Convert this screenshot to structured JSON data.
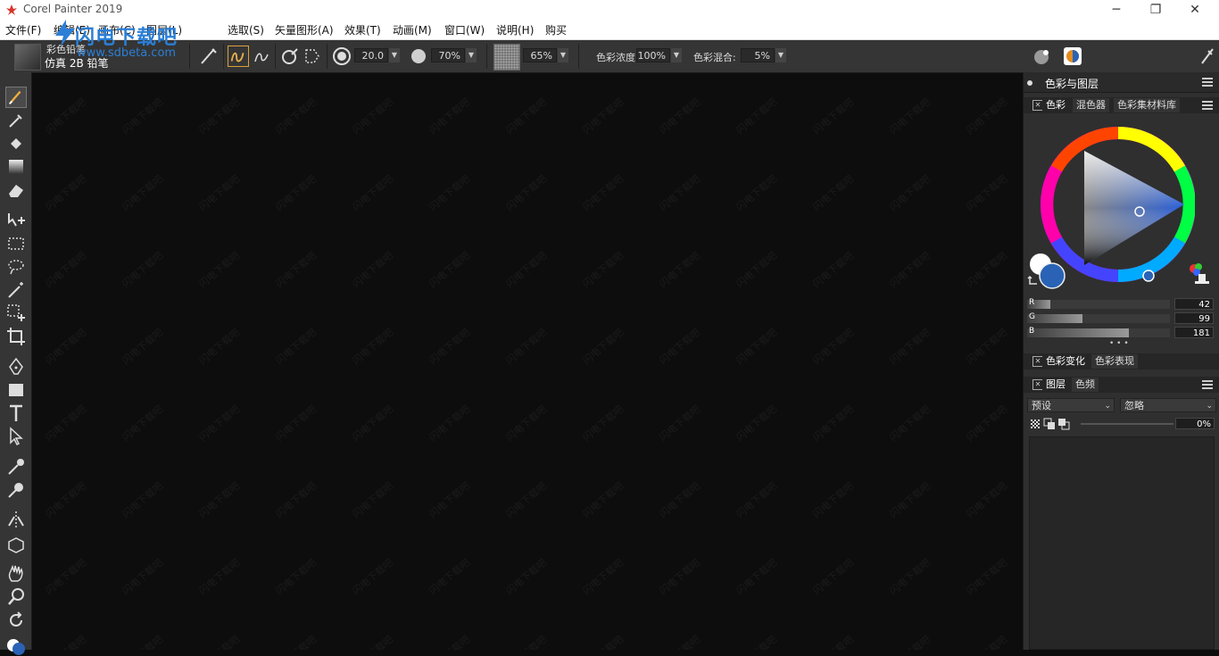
{
  "window": {
    "title": "Corel Painter 2019",
    "minimize": "─",
    "maximize": "❐",
    "close": "✕"
  },
  "menu": [
    {
      "label": "文件(F)"
    },
    {
      "label": "编辑(E)"
    },
    {
      "label": "画布(C)"
    },
    {
      "label": "图层(L)"
    },
    {
      "label": "选取(S)"
    },
    {
      "label": "矢量图形(A)"
    },
    {
      "label": "效果(T)"
    },
    {
      "label": "动画(M)"
    },
    {
      "label": "窗口(W)"
    },
    {
      "label": "说明(H)"
    },
    {
      "label": "购买"
    }
  ],
  "watermark_banner": {
    "text": "闪电下载吧",
    "url": "www.sdbeta.com"
  },
  "canvas_watermark": "闪电下载吧",
  "property_bar": {
    "brush_category": "彩色铅笔",
    "brush_variant": "仿真 2B 铅笔",
    "size": "20.0",
    "opacity": "70%",
    "grain": "65%",
    "resat_label": "色彩浓度:",
    "resat_value": "100%",
    "bleed_label": "色彩混合:",
    "bleed_value": "5%"
  },
  "panel": {
    "title": "色彩与图层",
    "color_tabs": [
      "色彩",
      "混色器",
      "色彩集材料库"
    ],
    "rgb": [
      {
        "label": "R",
        "value": "42",
        "fraction": 0.165
      },
      {
        "label": "G",
        "value": "99",
        "fraction": 0.388
      },
      {
        "label": "B",
        "value": "181",
        "fraction": 0.71
      }
    ],
    "more": "• • •",
    "variation_tabs": [
      "色彩变化",
      "色彩表现"
    ],
    "layer_tabs": [
      "图层",
      "色频"
    ],
    "composite_method": "预设",
    "blend_mode": "忽略",
    "layer_opacity": "0%"
  },
  "colors": {
    "main_color": "#2a63b5",
    "secondary_color": "#ffffff",
    "active_tool_accent": "#f0b040"
  }
}
